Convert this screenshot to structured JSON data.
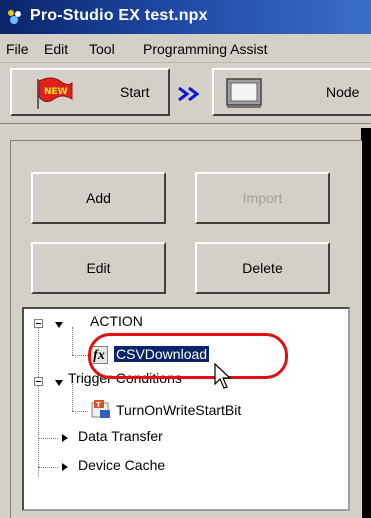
{
  "window": {
    "title": "Pro-Studio EX   test.npx"
  },
  "menu": {
    "items": [
      "File",
      "Edit",
      "Tool",
      "Programming Assist"
    ]
  },
  "toolbar": {
    "start_label": "Start",
    "node_label": "Node",
    "start_icon": "new-flag-icon",
    "node_icon": "monitor-icon"
  },
  "buttons": {
    "add": "Add",
    "import": "Import",
    "edit": "Edit",
    "delete": "Delete"
  },
  "tree": {
    "action_group": "ACTION",
    "action_item": "CSVDownload",
    "trigger_group": "Trigger Conditions",
    "trigger_item": "TurnOnWriteStartBit",
    "data_transfer": "Data Transfer",
    "device_cache": "Device Cache"
  },
  "colors": {
    "titlebar": "#0a246a",
    "selection": "#0a246a",
    "highlight": "#e01010",
    "face": "#d4d0c8"
  }
}
